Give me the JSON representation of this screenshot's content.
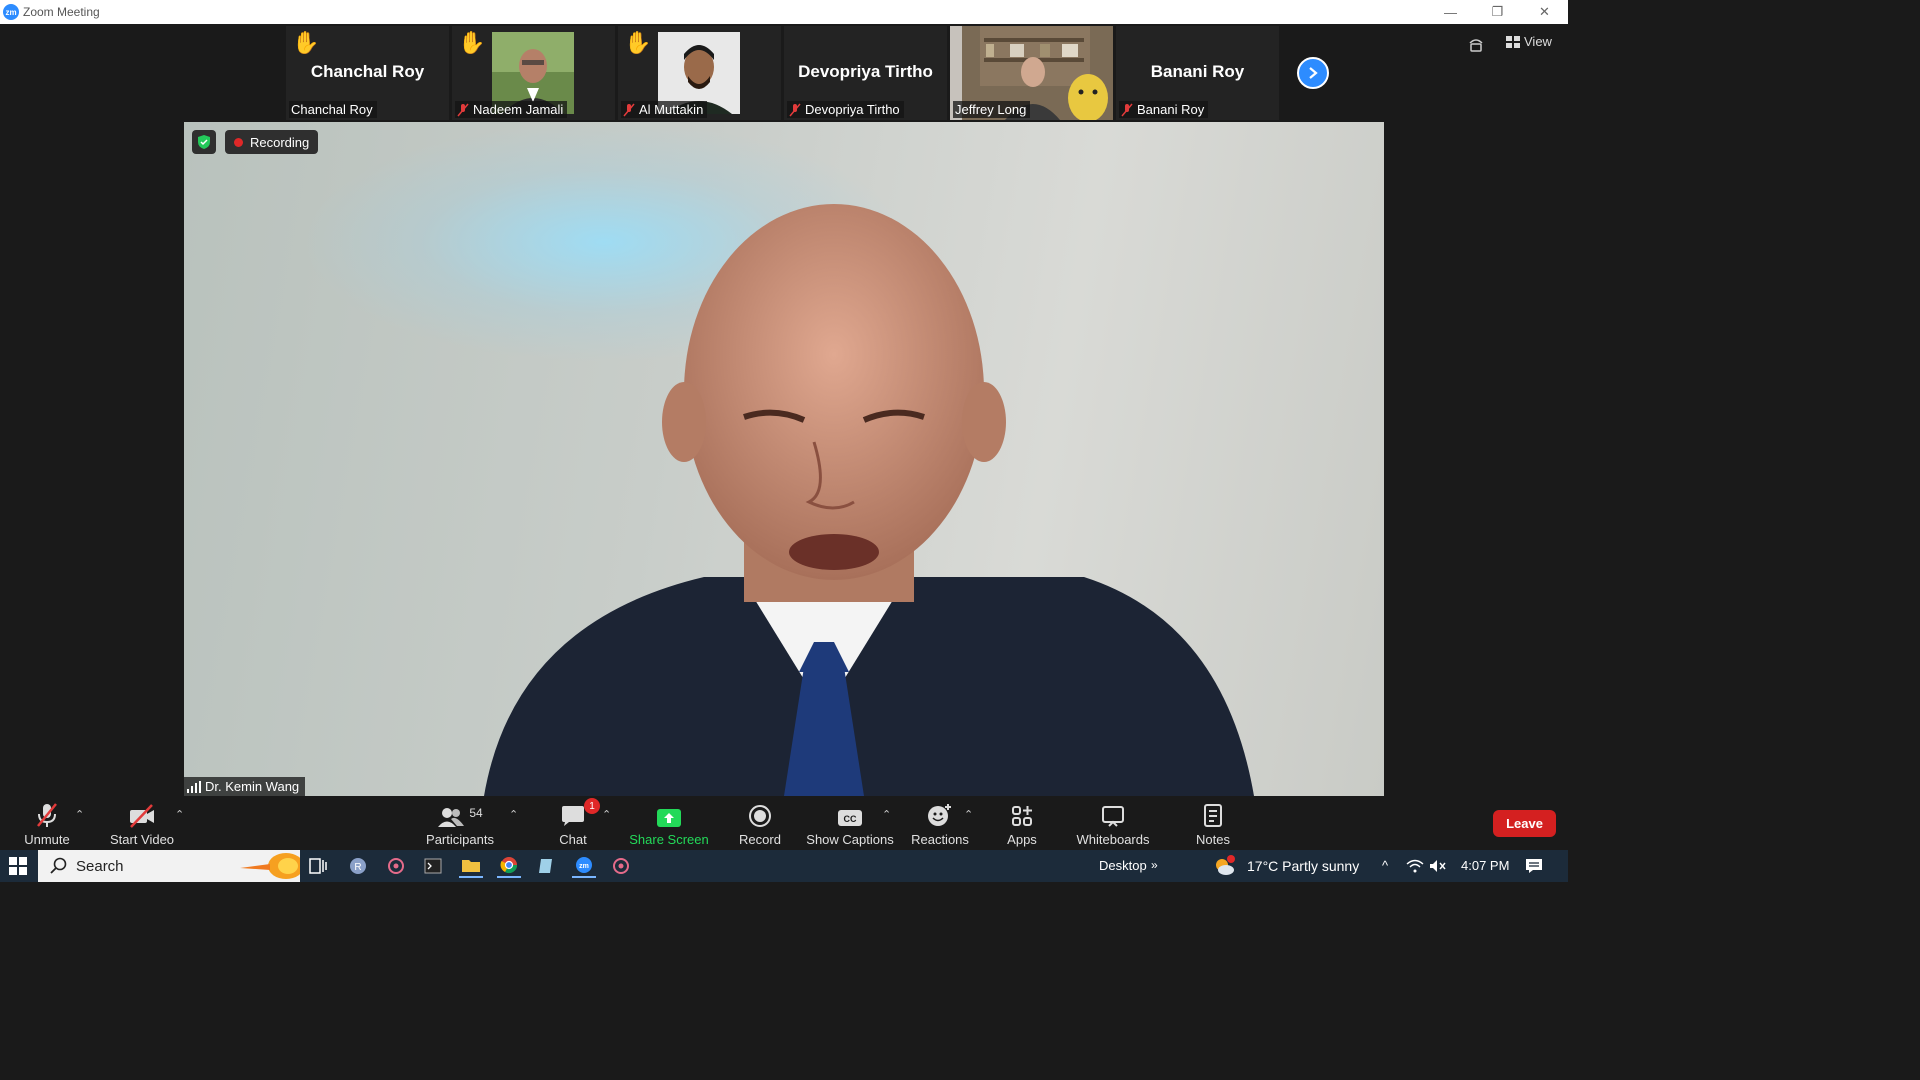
{
  "window": {
    "title": "Zoom Meeting"
  },
  "gallery": {
    "tiles": [
      {
        "display_name": "Chanchal Roy",
        "label": "Chanchal Roy",
        "hand_raised": true,
        "muted": false,
        "has_video": false
      },
      {
        "display_name": "",
        "label": "Nadeem Jamali",
        "hand_raised": true,
        "muted": true,
        "has_video": true
      },
      {
        "display_name": "",
        "label": "Al Muttakin",
        "hand_raised": true,
        "muted": true,
        "has_video": true
      },
      {
        "display_name": "Devopriya Tirtho",
        "label": "Devopriya Tirtho",
        "hand_raised": false,
        "muted": true,
        "has_video": false
      },
      {
        "display_name": "",
        "label": "Jeffrey Long",
        "hand_raised": false,
        "muted": false,
        "has_video": true
      },
      {
        "display_name": "Banani Roy",
        "label": "Banani Roy",
        "hand_raised": false,
        "muted": true,
        "has_video": false
      }
    ]
  },
  "top_right": {
    "view_label": "View"
  },
  "main": {
    "recording_label": "Recording",
    "speaker_name": "Dr. Kemin Wang"
  },
  "toolbar": {
    "unmute": "Unmute",
    "start_video": "Start Video",
    "participants": "Participants",
    "participants_count": "54",
    "chat": "Chat",
    "chat_badge": "1",
    "share_screen": "Share Screen",
    "record": "Record",
    "show_captions": "Show Captions",
    "reactions": "Reactions",
    "apps": "Apps",
    "whiteboards": "Whiteboards",
    "notes": "Notes",
    "leave": "Leave"
  },
  "taskbar": {
    "search": "Search",
    "desktop": "Desktop",
    "weather": "17°C  Partly sunny",
    "time": "4:07 PM"
  },
  "colors": {
    "accent": "#2d8cff",
    "share_green": "#23d959",
    "leave_red": "#d42020",
    "recording_red": "#e02828"
  }
}
